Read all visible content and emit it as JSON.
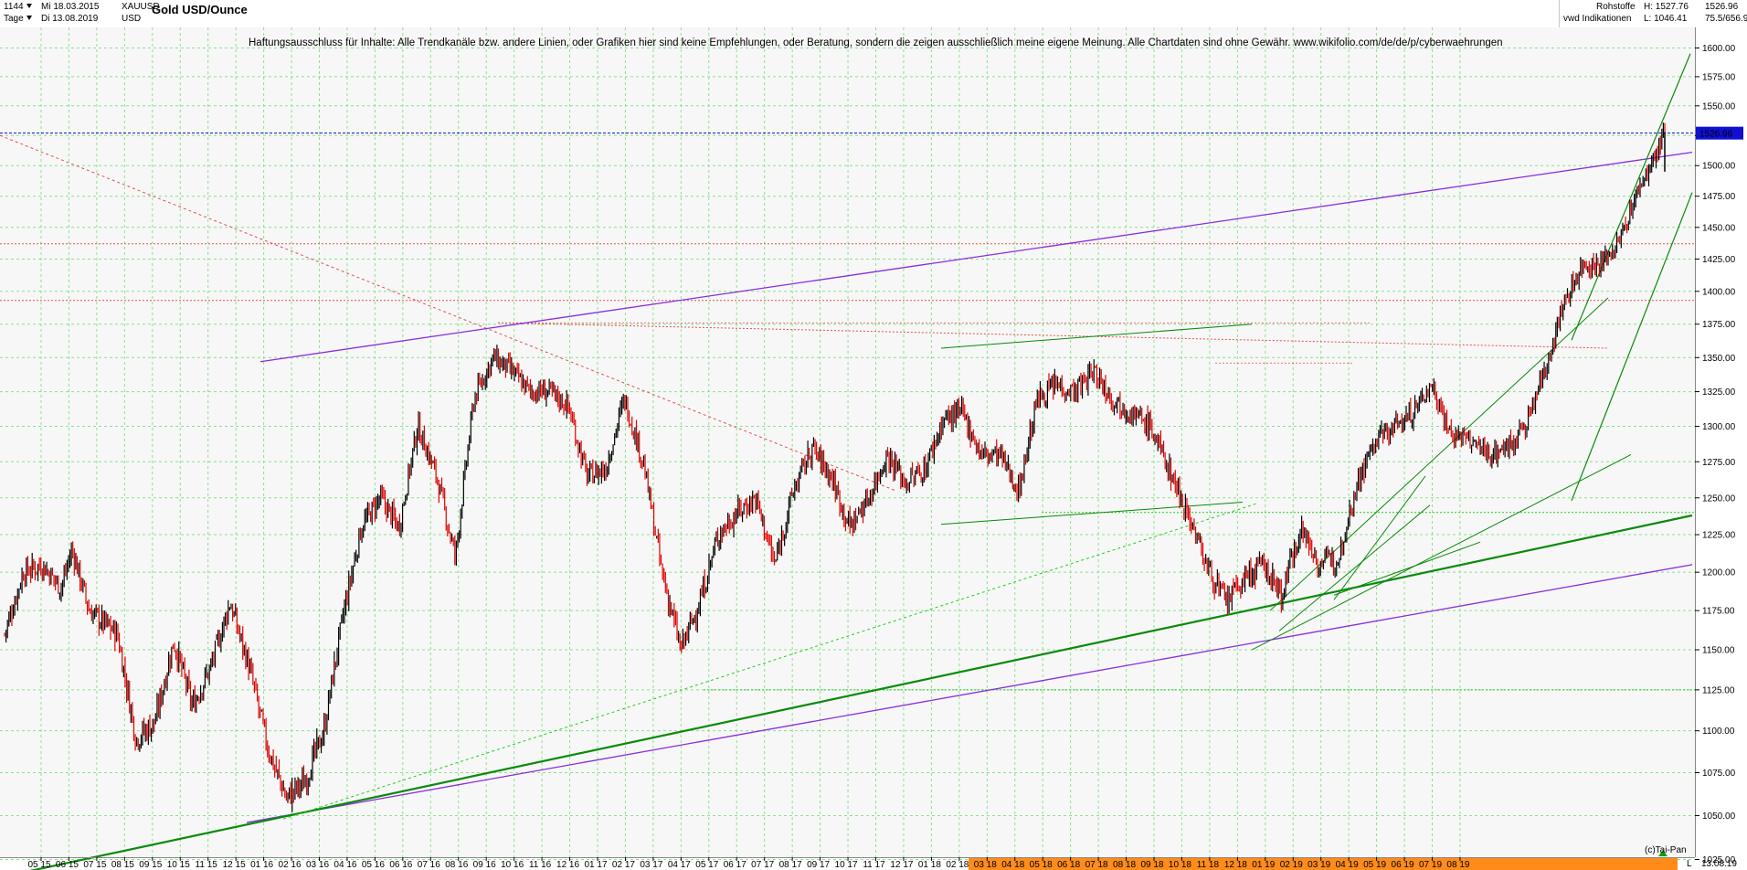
{
  "header": {
    "bars_count": "1144",
    "interval": "Tage",
    "start_date": "Mi 18.03.2015",
    "end_date": "Di 13.08.2019",
    "symbol": "XAUUSD",
    "currency": "USD",
    "title": "Gold USD/Ounce",
    "category": "Rohstoffe",
    "source": "vwd Indikationen",
    "high_label": "H: 1527.76",
    "low_label": "L: 1046.41",
    "last_value": "1526.96",
    "ratio_label": "75.5/656.9"
  },
  "disclaimer": "Haftungsausschluss für Inhalte: Alle Trendkanäle bzw. andere Linien, oder Grafiken hier sind keine Empfehlungen, oder Beratung, sondern die zeigen ausschließlich meine eigene Meinung. Alle Chartdaten sind ohne Gewähr.  www.wikifolio.com/de/de/p/cyberwaehrungen",
  "footer": {
    "credit": "(c)Tai-Pan",
    "scale_mode": "L",
    "last_date": "13.08.19"
  },
  "colors": {
    "background": "#ffffff",
    "plot_background": "#f7f7f7",
    "grid": "#8ee08e",
    "candle_up": "#000000",
    "candle_down": "#e00000",
    "purple_channel": "#8a2be2",
    "green_trend": "#0a8a0a",
    "dotted_red": "#e05050",
    "price_marker": "#1010d0",
    "timeline_highlight": "#ff8c1a"
  },
  "chart_data": {
    "type": "candlestick",
    "title": "Gold USD/Ounce",
    "yscale": "log",
    "ylim": [
      1015,
      1612
    ],
    "grid": true,
    "last_price": 1526.96,
    "y_ticks": [
      1025,
      1050,
      1075,
      1100,
      1125,
      1150,
      1175,
      1200,
      1225,
      1250,
      1275,
      1300,
      1325,
      1350,
      1375,
      1400,
      1425,
      1450,
      1475,
      1500,
      1525,
      1550,
      1575,
      1600
    ],
    "y_tick_labels": [
      "1025.00",
      "1050.00",
      "1075.00",
      "1100.00",
      "1125.00",
      "1150.00",
      "1175.00",
      "1200.00",
      "1225.00",
      "1250.00",
      "1275.00",
      "1300.00",
      "1325.00",
      "1350.00",
      "1375.00",
      "1400.00",
      "1425.00",
      "1450.00",
      "1475.00",
      "1500.00",
      "1525.00",
      "1550.00",
      "1575.00",
      "1600.00"
    ],
    "x_ticks": [
      "05 15",
      "06 15",
      "07 15",
      "08 15",
      "09 15",
      "10 15",
      "11 15",
      "12 15",
      "01 16",
      "02 16",
      "03 16",
      "04 16",
      "05 16",
      "06 16",
      "07 16",
      "08 16",
      "09 16",
      "10 16",
      "11 16",
      "12 16",
      "01 17",
      "02 17",
      "03 17",
      "04 17",
      "05 17",
      "06 17",
      "07 17",
      "08 17",
      "09 17",
      "10 17",
      "11 17",
      "12 17",
      "01 18",
      "02 18",
      "03 18",
      "04 18",
      "05 18",
      "06 18",
      "07 18",
      "08 18",
      "09 18",
      "10 18",
      "11 18",
      "12 18",
      "01 19",
      "02 19",
      "03 19",
      "04 19",
      "05 19",
      "06 19",
      "07 19",
      "08 19"
    ],
    "price_path": [
      [
        0,
        1160
      ],
      [
        1,
        1200
      ],
      [
        2,
        1205
      ],
      [
        3,
        1190
      ],
      [
        3.6,
        1215
      ],
      [
        4.5,
        1175
      ],
      [
        6,
        1160
      ],
      [
        7,
        1095
      ],
      [
        8,
        1105
      ],
      [
        9,
        1155
      ],
      [
        10,
        1115
      ],
      [
        11,
        1140
      ],
      [
        12,
        1180
      ],
      [
        13,
        1140
      ],
      [
        14,
        1090
      ],
      [
        15,
        1060
      ],
      [
        16,
        1070
      ],
      [
        17,
        1100
      ],
      [
        18,
        1170
      ],
      [
        19,
        1230
      ],
      [
        20,
        1250
      ],
      [
        21,
        1230
      ],
      [
        22,
        1300
      ],
      [
        23,
        1265
      ],
      [
        24,
        1210
      ],
      [
        25,
        1320
      ],
      [
        26,
        1350
      ],
      [
        27,
        1340
      ],
      [
        28,
        1325
      ],
      [
        29,
        1325
      ],
      [
        30,
        1315
      ],
      [
        31,
        1265
      ],
      [
        32,
        1270
      ],
      [
        33,
        1320
      ],
      [
        34,
        1275
      ],
      [
        35,
        1200
      ],
      [
        36,
        1150
      ],
      [
        37,
        1180
      ],
      [
        38,
        1225
      ],
      [
        39,
        1240
      ],
      [
        40,
        1250
      ],
      [
        41,
        1205
      ],
      [
        42,
        1255
      ],
      [
        43,
        1285
      ],
      [
        44,
        1265
      ],
      [
        45,
        1230
      ],
      [
        46,
        1250
      ],
      [
        47,
        1280
      ],
      [
        48,
        1260
      ],
      [
        49,
        1270
      ],
      [
        50,
        1305
      ],
      [
        51,
        1310
      ],
      [
        52,
        1280
      ],
      [
        53,
        1280
      ],
      [
        54,
        1255
      ],
      [
        55,
        1320
      ],
      [
        56,
        1330
      ],
      [
        57,
        1325
      ],
      [
        58,
        1340
      ],
      [
        59,
        1320
      ],
      [
        60,
        1310
      ],
      [
        61,
        1300
      ],
      [
        62,
        1270
      ],
      [
        63,
        1240
      ],
      [
        64,
        1205
      ],
      [
        65,
        1180
      ],
      [
        66,
        1195
      ],
      [
        67,
        1205
      ],
      [
        68,
        1185
      ],
      [
        69,
        1230
      ],
      [
        70,
        1205
      ],
      [
        71,
        1210
      ],
      [
        72,
        1260
      ],
      [
        73,
        1290
      ],
      [
        74,
        1300
      ],
      [
        75,
        1310
      ],
      [
        76,
        1330
      ],
      [
        77,
        1295
      ],
      [
        78,
        1290
      ],
      [
        79,
        1280
      ],
      [
        80,
        1285
      ],
      [
        81,
        1300
      ],
      [
        82,
        1340
      ],
      [
        83,
        1390
      ],
      [
        84,
        1420
      ],
      [
        85,
        1420
      ],
      [
        86,
        1440
      ],
      [
        87,
        1480
      ],
      [
        88,
        1510
      ],
      [
        88.4,
        1527
      ]
    ],
    "trend_lines": [
      {
        "name": "purple upper",
        "from": [
          "2016-03",
          1347
        ],
        "to": [
          "2019-08",
          1511
        ]
      },
      {
        "name": "purple lower",
        "from": [
          "2015-12",
          1046
        ],
        "to": [
          "2019-08",
          1205
        ]
      },
      {
        "name": "green main support",
        "from": [
          "2015-03",
          1015
        ],
        "to": [
          "2019-08",
          1238
        ]
      },
      {
        "name": "green resistance 2017-2018",
        "from": [
          "2017-09",
          1357
        ],
        "to": [
          "2018-06",
          1375
        ]
      }
    ]
  }
}
